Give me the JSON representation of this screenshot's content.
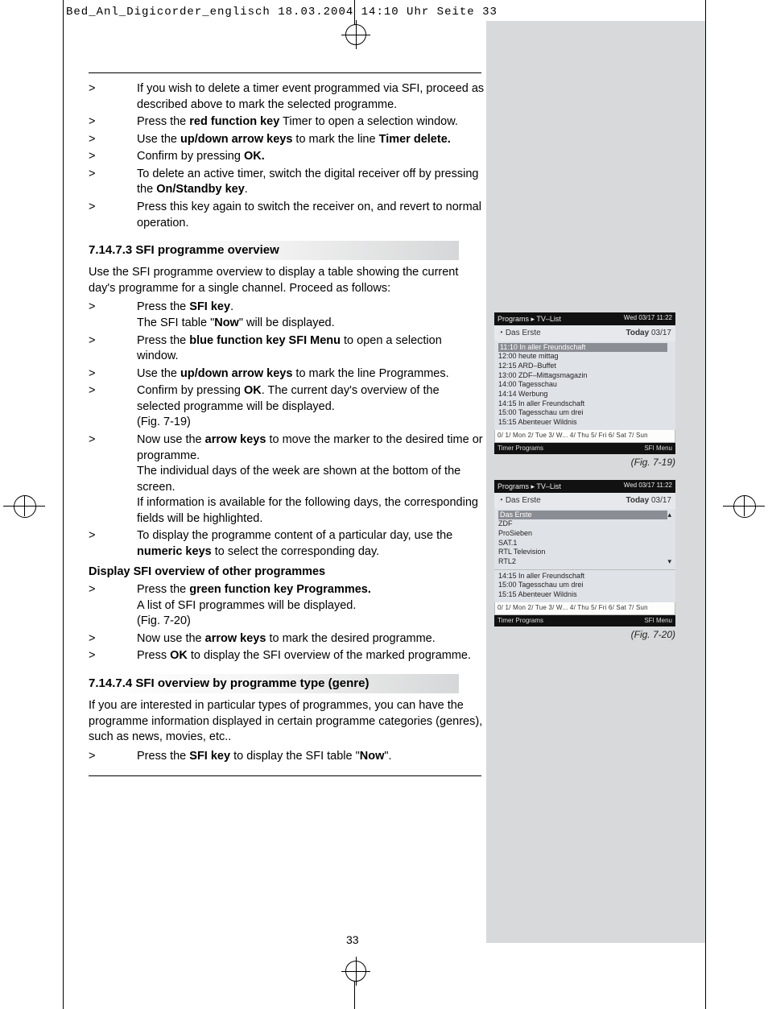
{
  "slug": "Bed_Anl_Digicorder_englisch  18.03.2004  14:10 Uhr  Seite 33",
  "page_number": "33",
  "intro_bullets": [
    {
      "text": "If you wish to delete a timer event programmed via SFI, proceed as described above to mark the selected programme."
    },
    {
      "html": "Press the <b>red function key</b> Timer to open a selection window."
    },
    {
      "html": "Use the <b>up/down arrow keys</b> to mark the line <b>Timer delete.</b>"
    },
    {
      "html": "Confirm by pressing <b>OK.</b>"
    },
    {
      "html": "To delete an active timer, switch the digital receiver off by pressing the <b>On/Standby key</b>."
    },
    {
      "text": "Press this key again to switch the receiver on, and revert to normal operation."
    }
  ],
  "sec1": {
    "title": "7.14.7.3 SFI programme overview",
    "intro": "Use the SFI programme overview to display a table showing the current day's programme for a single channel. Proceed as follows:",
    "bullets": [
      {
        "html": "Press the <b>SFI key</b>.<br>The SFI table \"<b>Now</b>\" will be displayed."
      },
      {
        "html": "Press the <b>blue function key SFI Menu</b> to open a selection window."
      },
      {
        "html": "Use the <b>up/down arrow keys</b> to mark the line Programmes."
      },
      {
        "html": "Confirm by pressing <b>OK</b>. The current day's overview of the selected programme will be displayed.<br>(Fig. 7-19)"
      },
      {
        "html": "Now use the <b>arrow keys</b> to move the marker to the desired time or programme.<br>The individual days of the week are shown at the bottom of the screen.<br>If information is available for the following days, the corresponding fields will be highlighted."
      },
      {
        "html": "To display the programme content of a particular day, use the <b>numeric keys</b> to select the corresponding day."
      }
    ],
    "subhead": "Display SFI overview of other programmes",
    "bullets2": [
      {
        "html": "Press the <b>green function key Programmes.</b><br>A list of SFI programmes will be displayed.<br>(Fig. 7-20)"
      },
      {
        "html": "Now use the <b>arrow keys</b> to mark the desired programme."
      },
      {
        "html": "Press <b>OK</b> to display the SFI overview of the marked programme."
      }
    ]
  },
  "sec2": {
    "title": "7.14.7.4 SFI overview by programme type (genre)",
    "intro": "If you are interested in particular types of programmes, you can have the programme information displayed in certain programme categories (genres), such as news, movies, etc..",
    "bullet": {
      "html": "Press the <b>SFI key</b> to display the SFI table \"<b>Now</b>\"."
    }
  },
  "fig719": {
    "breadcrumb": "Programs ▸ TV–List",
    "clock": "Wed 03/17  11:22",
    "channel": "Das Erste",
    "today": "Today 03/17",
    "rows": [
      "11:10 In aller Freundschaft",
      "12:00 heute mittag",
      "12:15 ARD–Buffet",
      "13:00 ZDF–Mittagsmagazin",
      "14:00 Tagesschau",
      "14:14 Werbung",
      "14:15 In aller Freundschaft",
      "15:00 Tagesschau um drei",
      "15:15 Abenteuer Wildnis"
    ],
    "days": "0/    1/ Mon  2/ Tue  3/ W...  4/ Thu  5/ Fri   6/ Sat  7/ Sun",
    "footer_left": "Timer        Programs",
    "footer_right": "SFI Menu",
    "caption": "(Fig. 7-19)"
  },
  "fig720": {
    "breadcrumb": "Programs ▸ TV–List",
    "clock": "Wed 03/17  11:22",
    "channel": "Das Erste",
    "today": "Today 03/17",
    "channels": [
      "Das Erste",
      "ZDF",
      "ProSieben",
      "SAT.1",
      "RTL Television",
      "RTL2"
    ],
    "tail": [
      "14:15 In aller Freundschaft",
      "15:00 Tagesschau um drei",
      "15:15 Abenteuer Wildnis"
    ],
    "days": "0/    1/ Mon  2/ Tue  3/ W...  4/ Thu  5/ Fri   6/ Sat  7/ Sun",
    "footer_left": "Timer        Programs",
    "footer_right": "SFI Menu",
    "caption": "(Fig. 7-20)"
  }
}
